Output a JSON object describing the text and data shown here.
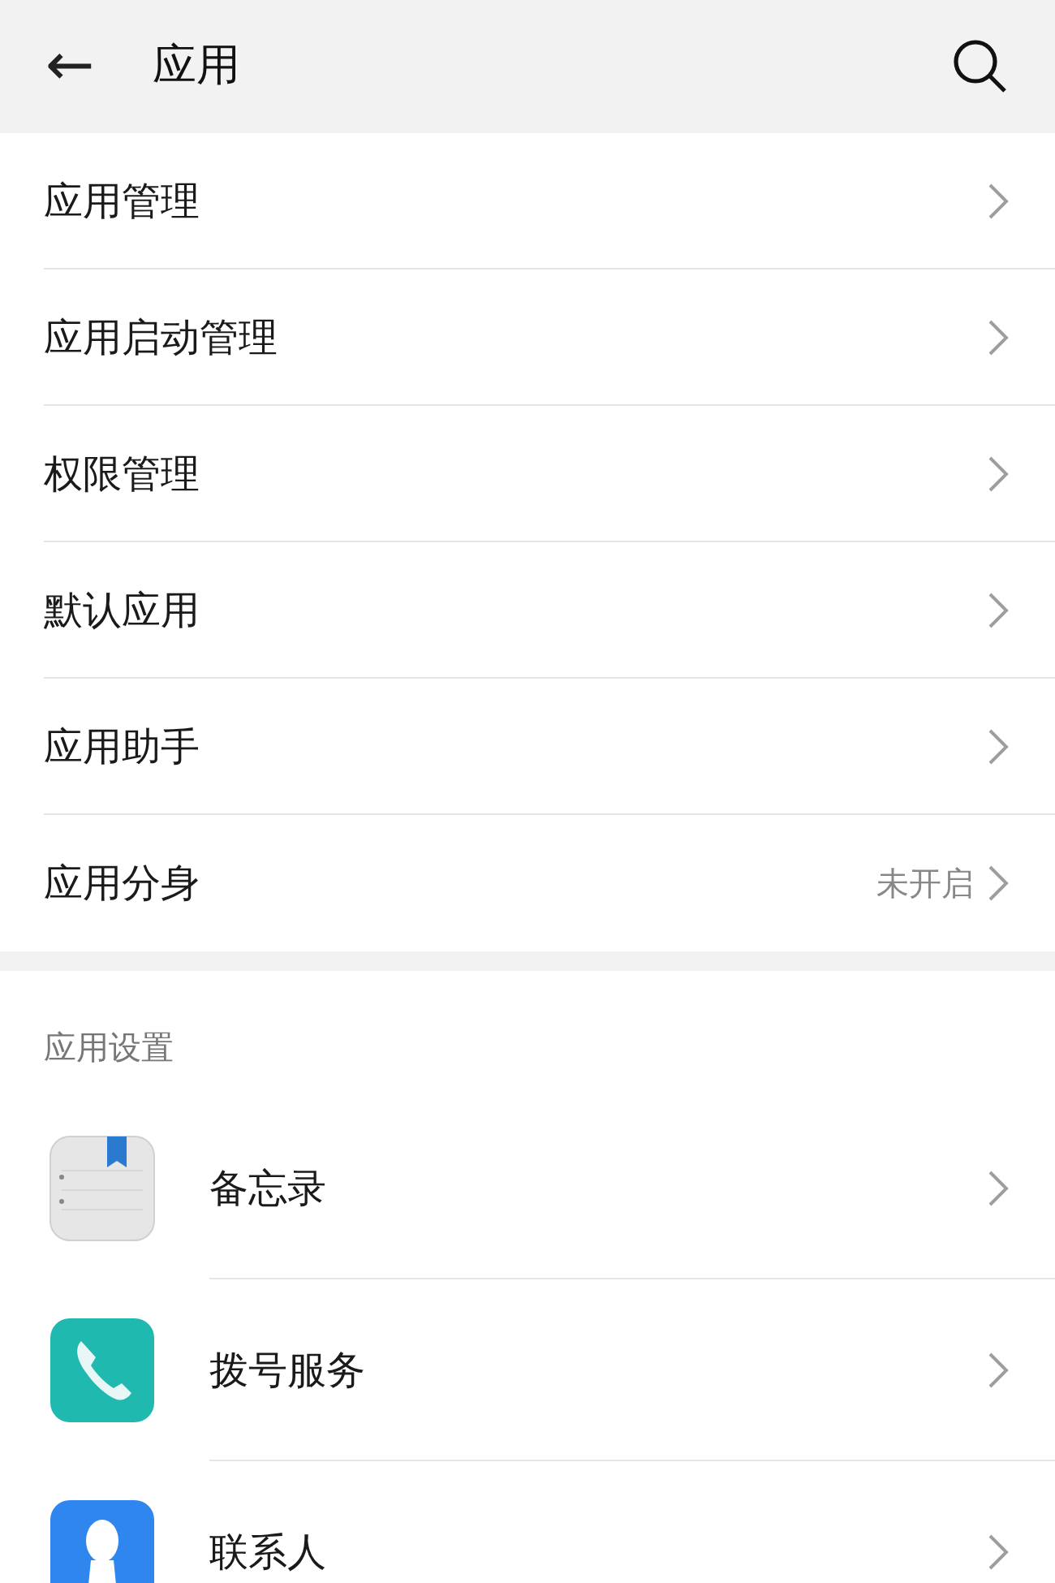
{
  "header": {
    "back": "←",
    "title": "应用"
  },
  "menu": [
    {
      "label": "应用管理"
    },
    {
      "label": "应用启动管理"
    },
    {
      "label": "权限管理"
    },
    {
      "label": "默认应用"
    },
    {
      "label": "应用助手"
    },
    {
      "label": "应用分身",
      "value": "未开启"
    }
  ],
  "section": {
    "title": "应用设置",
    "apps": [
      {
        "kind": "notes",
        "label": "备忘录"
      },
      {
        "kind": "phone",
        "label": "拨号服务"
      },
      {
        "kind": "contacts",
        "label": "联系人"
      }
    ]
  }
}
